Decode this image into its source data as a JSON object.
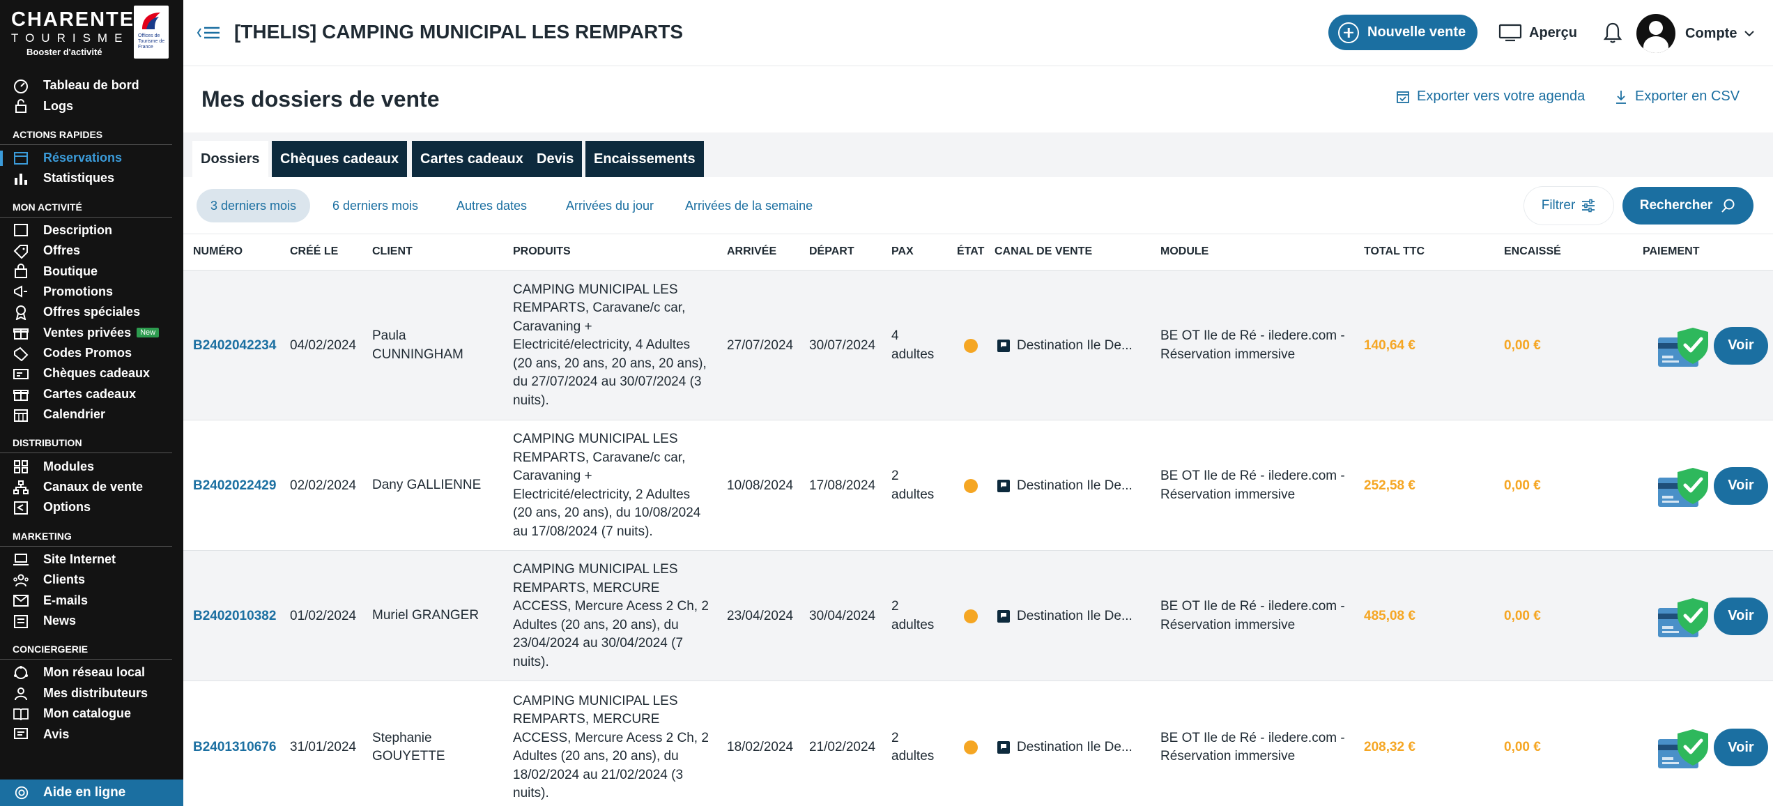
{
  "logo": {
    "line1": "CHARENTES",
    "line2": "TOURISME",
    "tagline": "Booster d'activité",
    "ot_text": "Offices de Tourisme de France"
  },
  "sidebar": {
    "top": [
      {
        "label": "Tableau de bord",
        "icon": "dashboard-icon"
      },
      {
        "label": "Logs",
        "icon": "lock-icon"
      }
    ],
    "sections": [
      {
        "title": "ACTIONS RAPIDES",
        "items": [
          {
            "label": "Réservations",
            "icon": "calendar-icon",
            "active": true
          },
          {
            "label": "Statistiques",
            "icon": "bar-chart-icon"
          }
        ]
      },
      {
        "title": "MON ACTIVITÉ",
        "items": [
          {
            "label": "Description",
            "icon": "building-icon"
          },
          {
            "label": "Offres",
            "icon": "tag-icon"
          },
          {
            "label": "Boutique",
            "icon": "bag-icon"
          },
          {
            "label": "Promotions",
            "icon": "megaphone-icon"
          },
          {
            "label": "Offres spéciales",
            "icon": "award-icon"
          },
          {
            "label": "Ventes privées",
            "icon": "gift-icon",
            "badge": "New"
          },
          {
            "label": "Codes Promos",
            "icon": "ticket-icon"
          },
          {
            "label": "Chèques cadeaux",
            "icon": "voucher-icon"
          },
          {
            "label": "Cartes cadeaux",
            "icon": "gift-card-icon"
          },
          {
            "label": "Calendrier",
            "icon": "calendar-grid-icon"
          }
        ]
      },
      {
        "title": "DISTRIBUTION",
        "items": [
          {
            "label": "Modules",
            "icon": "grid-icon"
          },
          {
            "label": "Canaux de vente",
            "icon": "sitemap-icon"
          },
          {
            "label": "Options",
            "icon": "share-icon"
          }
        ]
      },
      {
        "title": "MARKETING",
        "items": [
          {
            "label": "Site Internet",
            "icon": "laptop-icon"
          },
          {
            "label": "Clients",
            "icon": "users-icon"
          },
          {
            "label": "E-mails",
            "icon": "mail-icon"
          },
          {
            "label": "News",
            "icon": "newspaper-icon"
          }
        ]
      },
      {
        "title": "CONCIERGERIE",
        "items": [
          {
            "label": "Mon réseau local",
            "icon": "network-icon"
          },
          {
            "label": "Mes distributeurs",
            "icon": "distributor-icon"
          },
          {
            "label": "Mon catalogue",
            "icon": "book-icon"
          },
          {
            "label": "Avis",
            "icon": "review-icon"
          }
        ]
      }
    ],
    "help": "Aide en ligne"
  },
  "topbar": {
    "title": "[THELIS] CAMPING MUNICIPAL LES REMPARTS",
    "new_sale": "Nouvelle vente",
    "preview": "Aperçu",
    "account": "Compte"
  },
  "page": {
    "title": "Mes dossiers de vente",
    "export_agenda": "Exporter vers votre agenda",
    "export_csv": "Exporter en CSV"
  },
  "tabs": [
    {
      "label": "Dossiers",
      "active": true
    },
    {
      "label": "Chèques cadeaux"
    },
    {
      "label": "Cartes cadeaux"
    },
    {
      "label": "Devis"
    },
    {
      "label": "Encaissements"
    }
  ],
  "periods": [
    {
      "label": "3 derniers mois",
      "active": true
    },
    {
      "label": "6 derniers mois"
    },
    {
      "label": "Autres dates"
    },
    {
      "label": "Arrivées du jour"
    },
    {
      "label": "Arrivées de la semaine"
    }
  ],
  "filter_label": "Filtrer",
  "search_label": "Rechercher",
  "table": {
    "headers": [
      "NUMÉRO",
      "CRÉÉ LE",
      "CLIENT",
      "PRODUITS",
      "ARRIVÉE",
      "DÉPART",
      "PAX",
      "ÉTAT",
      "CANAL DE VENTE",
      "MODULE",
      "TOTAL TTC",
      "ENCAISSÉ",
      "PAIEMENT"
    ],
    "status_color": "#f5a623",
    "action_label": "Voir",
    "rows": [
      {
        "numero": "B2402042234",
        "cree_le": "04/02/2024",
        "client": [
          "Paula",
          "CUNNINGHAM"
        ],
        "produits": [
          "CAMPING MUNICIPAL LES",
          "REMPARTS, Caravane/c car,",
          "Caravaning +",
          "Electricité/electricity, 4 Adultes",
          "(20 ans, 20 ans, 20 ans, 20 ans),",
          "du 27/07/2024 au 30/07/2024 (3",
          "nuits)."
        ],
        "arrivee": "27/07/2024",
        "depart": "30/07/2024",
        "pax": [
          "4",
          "adultes"
        ],
        "canal": "Destination Ile De...",
        "module": [
          "BE OT Ile de Ré - iledere.com -",
          "Réservation immersive"
        ],
        "total": "140,64 €",
        "encaisse": "0,00 €"
      },
      {
        "numero": "B2402022429",
        "cree_le": "02/02/2024",
        "client": [
          "Dany GALLIENNE"
        ],
        "produits": [
          "CAMPING MUNICIPAL LES",
          "REMPARTS, Caravane/c car,",
          "Caravaning +",
          "Electricité/electricity, 2 Adultes",
          "(20 ans, 20 ans), du 10/08/2024",
          "au 17/08/2024 (7 nuits)."
        ],
        "arrivee": "10/08/2024",
        "depart": "17/08/2024",
        "pax": [
          "2",
          "adultes"
        ],
        "canal": "Destination Ile De...",
        "module": [
          "BE OT Ile de Ré - iledere.com -",
          "Réservation immersive"
        ],
        "total": "252,58 €",
        "encaisse": "0,00 €"
      },
      {
        "numero": "B2402010382",
        "cree_le": "01/02/2024",
        "client": [
          "Muriel GRANGER"
        ],
        "produits": [
          "CAMPING MUNICIPAL LES",
          "REMPARTS, MERCURE",
          "ACCESS, Mercure Acess 2 Ch, 2",
          "Adultes (20 ans, 20 ans), du",
          "23/04/2024 au 30/04/2024 (7",
          "nuits)."
        ],
        "arrivee": "23/04/2024",
        "depart": "30/04/2024",
        "pax": [
          "2",
          "adultes"
        ],
        "canal": "Destination Ile De...",
        "module": [
          "BE OT Ile de Ré - iledere.com -",
          "Réservation immersive"
        ],
        "total": "485,08 €",
        "encaisse": "0,00 €"
      },
      {
        "numero": "B2401310676",
        "cree_le": "31/01/2024",
        "client": [
          "Stephanie",
          "GOUYETTE"
        ],
        "produits": [
          "CAMPING MUNICIPAL LES",
          "REMPARTS, MERCURE",
          "ACCESS, Mercure Acess 2 Ch, 2",
          "Adultes (20 ans, 20 ans), du",
          "18/02/2024 au 21/02/2024 (3",
          "nuits)."
        ],
        "arrivee": "18/02/2024",
        "depart": "21/02/2024",
        "pax": [
          "2",
          "adultes"
        ],
        "canal": "Destination Ile De...",
        "module": [
          "BE OT Ile de Ré - iledere.com -",
          "Réservation immersive"
        ],
        "total": "208,32 €",
        "encaisse": "0,00 €"
      }
    ]
  }
}
